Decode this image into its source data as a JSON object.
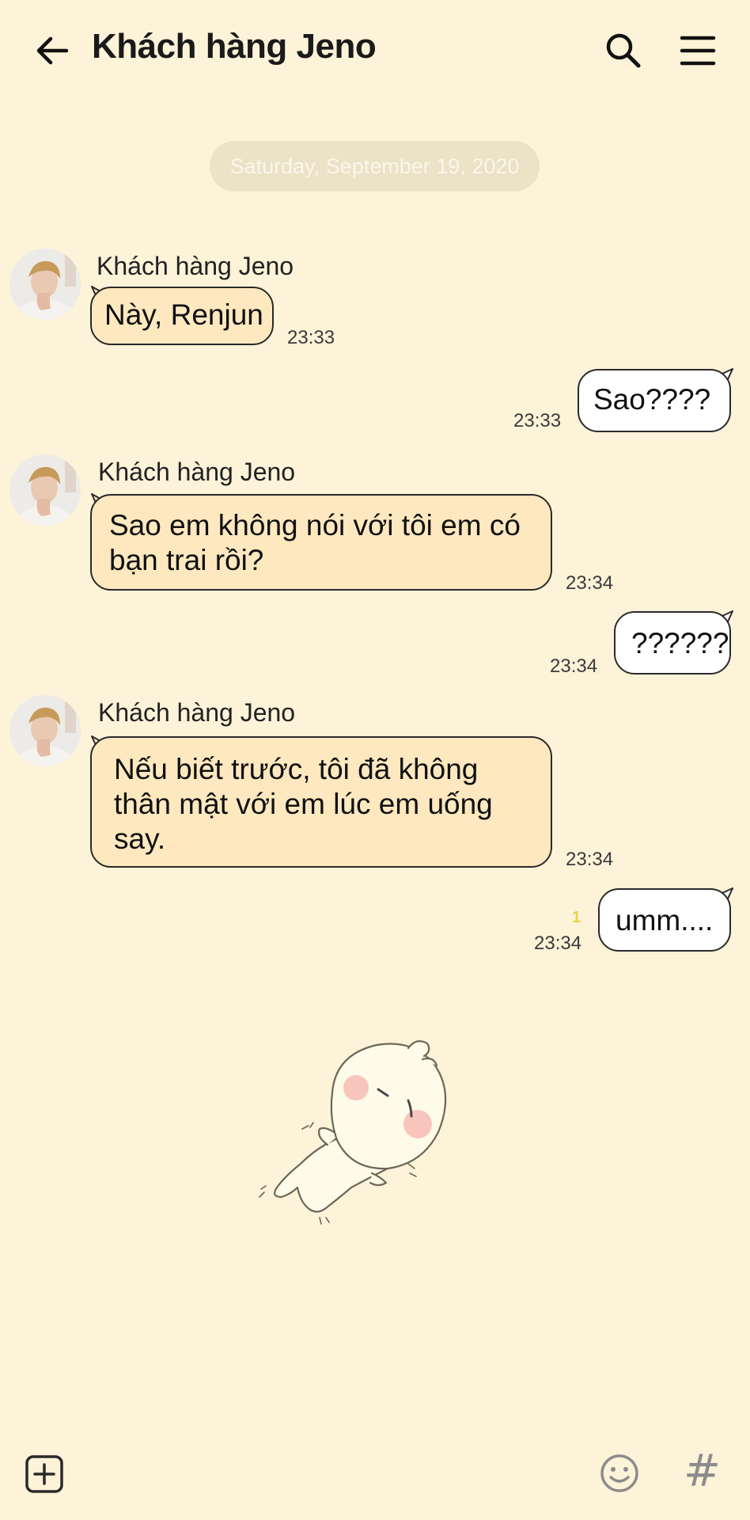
{
  "header": {
    "title": "Khách hàng Jeno"
  },
  "date_separator": "Saturday, September 19, 2020",
  "messages": [
    {
      "sender": "Khách hàng Jeno",
      "text": "Này, Renjun",
      "time": "23:33"
    },
    {
      "text": "Sao????",
      "time": "23:33"
    },
    {
      "sender": "Khách hàng Jeno",
      "lines": [
        "Sao em không nói với tôi em có",
        "bạn trai rồi?"
      ],
      "time": "23:34"
    },
    {
      "text": "??????",
      "time": "23:34"
    },
    {
      "sender": "Khách hàng Jeno",
      "lines": [
        "Nếu biết trước, tôi đã  không",
        "thân mật với em lúc em uống",
        "say."
      ],
      "time": "23:34"
    },
    {
      "text": "umm....",
      "time": "23:34",
      "unread": "1"
    }
  ],
  "bottom": {
    "hash": "#"
  },
  "colors": {
    "background": "#fdf3d8",
    "incoming_bubble": "#fde8bf",
    "outgoing_bubble": "#ffffff",
    "date_pill": "#ece2c6",
    "unread": "#e8d34a"
  },
  "icons": [
    "back-arrow-icon",
    "search-icon",
    "menu-icon",
    "plus-box-icon",
    "emoji-icon",
    "hash-icon"
  ]
}
